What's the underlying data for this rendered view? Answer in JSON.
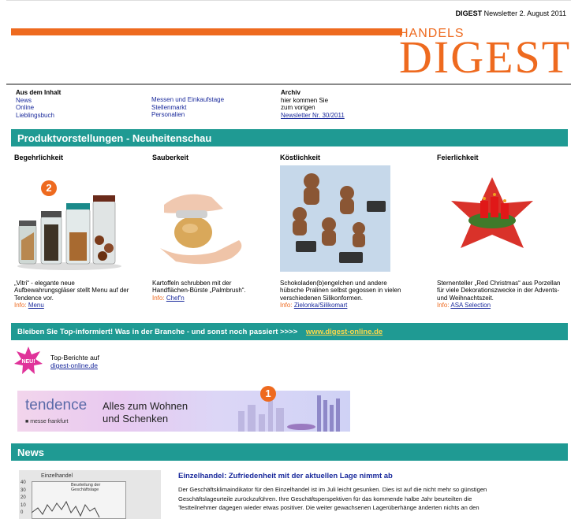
{
  "header": {
    "brand_short": "DIGEST",
    "newsletter_label": "Newsletter 2. August 2011",
    "logo_top": "HANDELS",
    "logo_main": "DIGEST"
  },
  "toc": {
    "heading": "Aus dem Inhalt",
    "col1": [
      "News",
      "Online",
      "Lieblingsbuch"
    ],
    "col2": [
      "Messen und Einkaufstage",
      "Stellenmarkt",
      "Personalien"
    ],
    "archiv_heading": "Archiv",
    "archiv_lines": [
      "hier kommen Sie",
      "zum vorigen"
    ],
    "archiv_link": "Newsletter Nr. 30/2011"
  },
  "section_title": "Produktvorstellungen - Neuheitenschau",
  "products": [
    {
      "heading": "Begehrlichkeit",
      "desc": "„Vitri“ - elegante neue Aufbewahrungsgläser stellt Menu auf der Tendence vor.",
      "info_label": "Info:",
      "info_link": "Menu"
    },
    {
      "heading": "Sauberkeit",
      "desc": "Kartoffeln schrubben mit der Handflächen-Bürste „Palmbrush“.",
      "info_label": "Info:",
      "info_link": "Chef'n"
    },
    {
      "heading": "Köstlichkeit",
      "desc": "Schokoladen(b)engelchen und andere hübsche Pralinen selbst gegossen in vielen verschiedenen Silikonformen.",
      "info_label": "Info:",
      "info_link": "Zielonka/Silikomart"
    },
    {
      "heading": "Feierlichkeit",
      "desc": "Sternenteller „Red Christmas“ aus Porzellan für viele Dekorationszwecke in der Advents- und Weihnachtszeit.",
      "info_label": "Info:",
      "info_link": "ASA Selection"
    }
  ],
  "promo": {
    "text": "Bleiben Sie Top-informiert! Was in der Branche - und sonst noch passiert >>>>",
    "link": "www.digest-online.de"
  },
  "badge": {
    "label": "NEU!",
    "line1": "Top-Berichte auf",
    "link": "digest-online.de"
  },
  "banner": {
    "brand": "tendence",
    "sub": "messe frankfurt",
    "claim_line1": "Alles zum Wohnen",
    "claim_line2": "und Schenken"
  },
  "markers": {
    "m1": "1",
    "m2": "2"
  },
  "news": {
    "bar_title": "News",
    "chart_label": "Einzelhandel",
    "chart_legend": "Beurteilung der Geschäftslage",
    "chart_ticks": [
      "40",
      "30",
      "20",
      "10",
      "0"
    ],
    "headline": "Einzelhandel: Zufriedenheit mit der aktuellen Lage nimmt ab",
    "body": [
      "Der Geschäftsklimaindikator für den Einzelhandel ist im Juli leicht gesunken. Dies ist auf die nicht mehr so günstigen",
      "Geschäftslageurteile zurückzuführen. Ihre Geschäftsperspektiven für das kommende halbe Jahr beurteilten die",
      "Testteilnehmer dagegen wieder etwas positiver. Die weiter gewachsenen Lagerüberhänge änderten nichts an den"
    ]
  },
  "colors": {
    "accent_orange": "#ee6a1f",
    "teal": "#1f9a93",
    "link_blue": "#1a2a9c"
  }
}
